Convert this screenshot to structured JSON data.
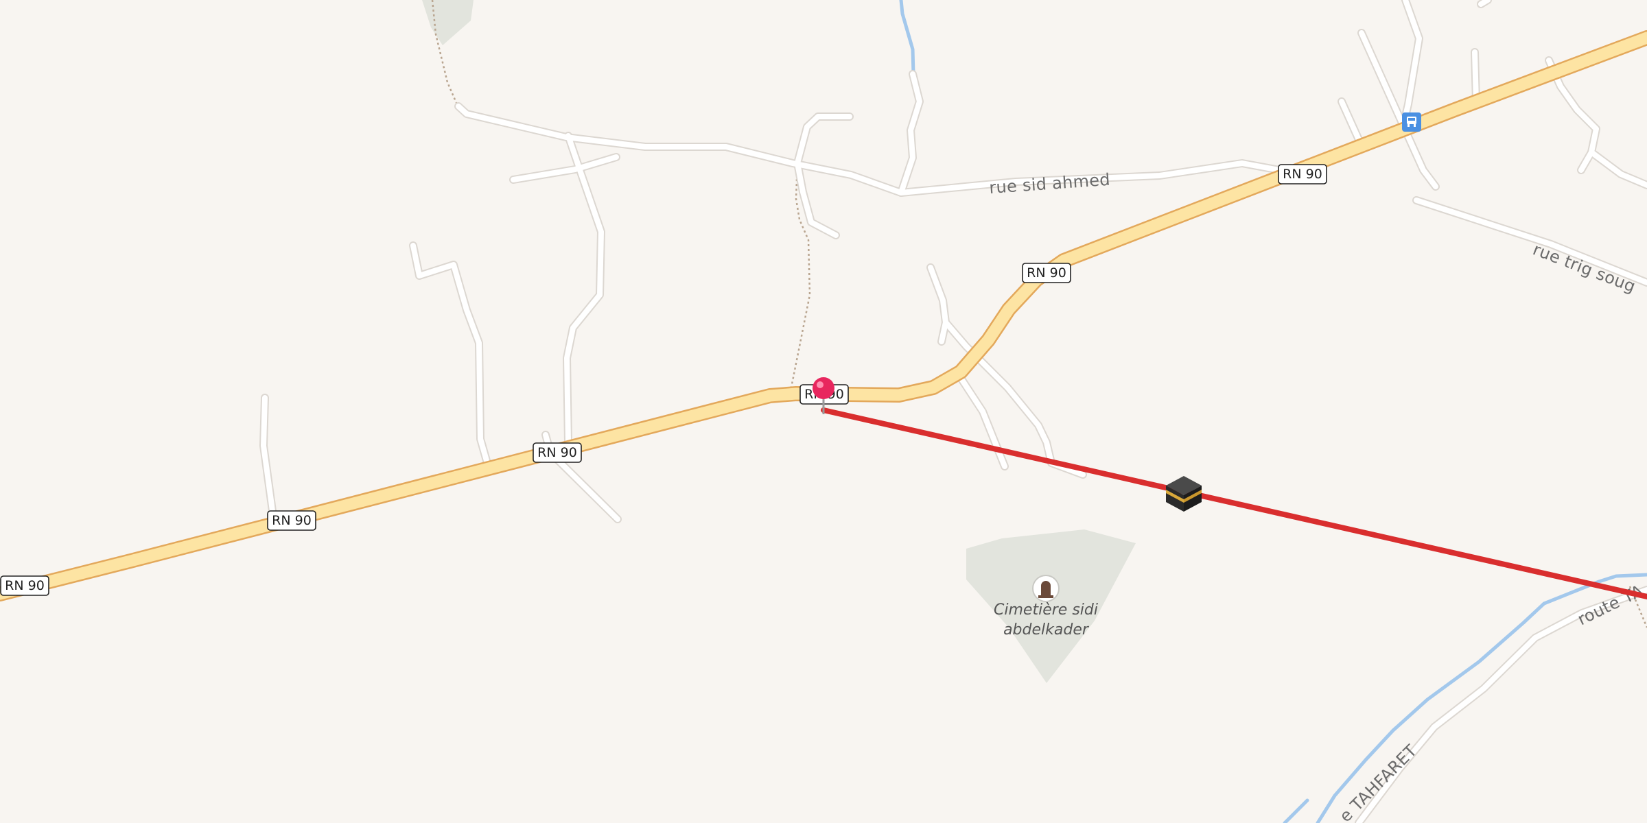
{
  "map": {
    "route_color": "#d92e2e",
    "road_shields": [
      {
        "id": "rn90-a",
        "label": "RN 90"
      },
      {
        "id": "rn90-b",
        "label": "RN 90"
      },
      {
        "id": "rn90-c",
        "label": "RN 90"
      },
      {
        "id": "rn90-d",
        "label": "RN 90"
      },
      {
        "id": "rn90-e",
        "label": "RN 90"
      },
      {
        "id": "rn90-f",
        "label": "RN 90"
      }
    ],
    "street_labels": {
      "rue_sid_ahmed": "rue sid ahmed",
      "rue_trig_soug": "rue trig soug",
      "route_tahfaret_upper": "route TA",
      "route_tahfaret_lower": "e TAHFARET"
    },
    "poi": {
      "cemetery_line1": "Cimetière sidi",
      "cemetery_line2": "abdelkader",
      "cemetery_icon": "cemetery-icon"
    },
    "markers": {
      "start_pin": "red-pin-marker-icon",
      "destination": "kaaba-icon",
      "bus_stop": "bus-stop-icon"
    }
  }
}
